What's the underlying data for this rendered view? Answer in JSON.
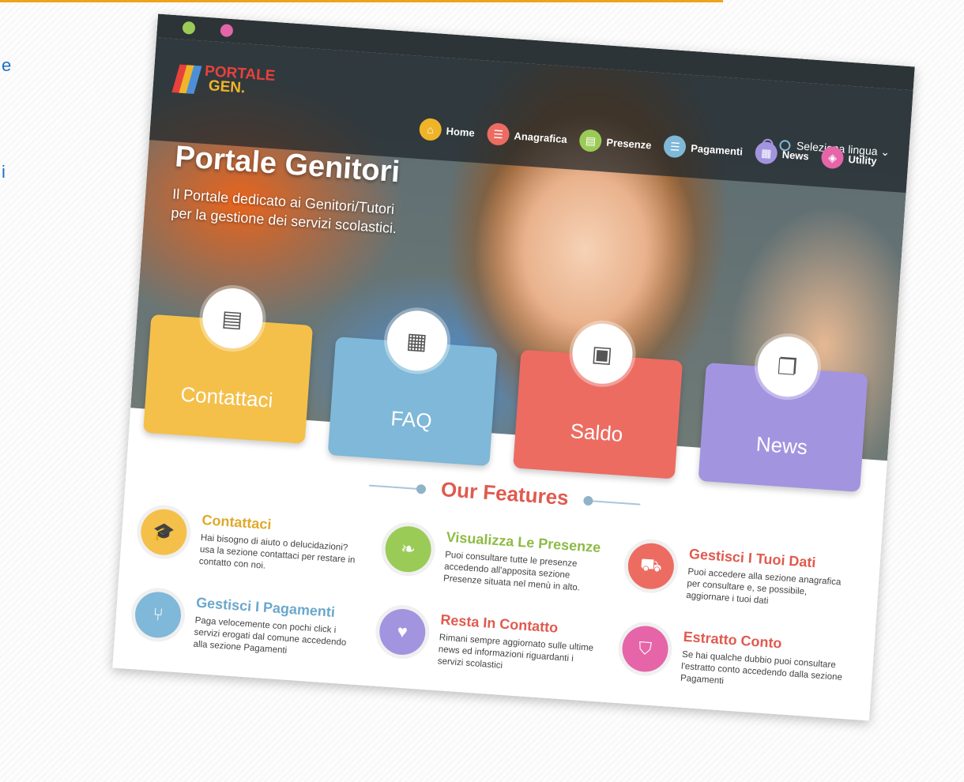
{
  "colors": {
    "accent_line": "#f0a21c",
    "yellow": "#f4c04a",
    "blue": "#7fb8d8",
    "red": "#ec6c62",
    "purple": "#a394e0",
    "green": "#9bcb57",
    "pink": "#e565a8",
    "navbar": "#2c3437"
  },
  "side_letters": [
    "e",
    "i"
  ],
  "logo": {
    "line1": "PORTALE",
    "line2": "GEN."
  },
  "language": {
    "label": "Seleziona lingua ⌄",
    "icon": "globe-icon"
  },
  "menu": [
    {
      "label": "Home",
      "icon": "home-icon",
      "color": "#f0b429",
      "glyph": "⌂"
    },
    {
      "label": "Anagrafica",
      "icon": "list-icon",
      "color": "#ec6c62",
      "glyph": "☰"
    },
    {
      "label": "Presenze",
      "icon": "document-icon",
      "color": "#9bcb57",
      "glyph": "▤"
    },
    {
      "label": "Pagamenti",
      "icon": "list-icon",
      "color": "#7fb8d8",
      "glyph": "☰"
    },
    {
      "label": "News",
      "icon": "calendar-icon",
      "color": "#a394e0",
      "glyph": "▦"
    },
    {
      "label": "Utility",
      "icon": "code-icon",
      "color": "#e565a8",
      "glyph": "◈"
    }
  ],
  "hero": {
    "title": "Portale Genitori",
    "subtitle": "Il Portale dedicato ai Genitori/Tutori per la gestione dei servizi scolastici."
  },
  "tiles": [
    {
      "label": "Contattaci",
      "icon": "document-icon",
      "glyph": "▤",
      "color": "#f4c04a"
    },
    {
      "label": "FAQ",
      "icon": "calendar-icon",
      "glyph": "▦",
      "color": "#7fb8d8"
    },
    {
      "label": "Saldo",
      "icon": "image-icon",
      "glyph": "▣",
      "color": "#ec6c62"
    },
    {
      "label": "News",
      "icon": "copy-icon",
      "glyph": "❐",
      "color": "#a394e0"
    }
  ],
  "features_heading": "Our Features",
  "features": [
    {
      "title": "Contattaci",
      "desc": "Hai bisogno di aiuto o delucidazioni? usa la sezione contattaci per restare in contatto con noi.",
      "icon": "graduation-cap-icon",
      "glyph": "🎓",
      "color": "#f4c04a"
    },
    {
      "title": "Visualizza Le Presenze",
      "desc": "Puoi consultare tutte le presenze accedendo all'apposita sezione Presenze situata nel menù in alto.",
      "icon": "leaf-icon",
      "glyph": "❧",
      "color": "#9bcb57"
    },
    {
      "title": "Gestisci I Tuoi Dati",
      "desc": "Puoi accedere alla sezione anagrafica per consultare e, se possibile, aggiornare i tuoi dati",
      "icon": "car-icon",
      "glyph": "⛟",
      "color": "#ec6c62"
    },
    {
      "title": "Gestisci I Pagamenti",
      "desc": "Paga velocemente con pochi click i servizi erogati dal comune accedendo alla sezione Pagamenti",
      "icon": "cutlery-icon",
      "glyph": "⑂",
      "color": "#7fb8d8"
    },
    {
      "title": "Resta In Contatto",
      "desc": "Rimani sempre aggiornato sulle ultime news ed informazioni riguardanti i servizi scolastici",
      "icon": "heart-icon",
      "glyph": "♥",
      "color": "#a394e0"
    },
    {
      "title": "Estratto Conto",
      "desc": "Se hai qualche dubbio puoi consultare l'estratto conto accedendo dalla sezione Pagamenti",
      "icon": "shield-icon",
      "glyph": "⛉",
      "color": "#e565a8"
    }
  ]
}
